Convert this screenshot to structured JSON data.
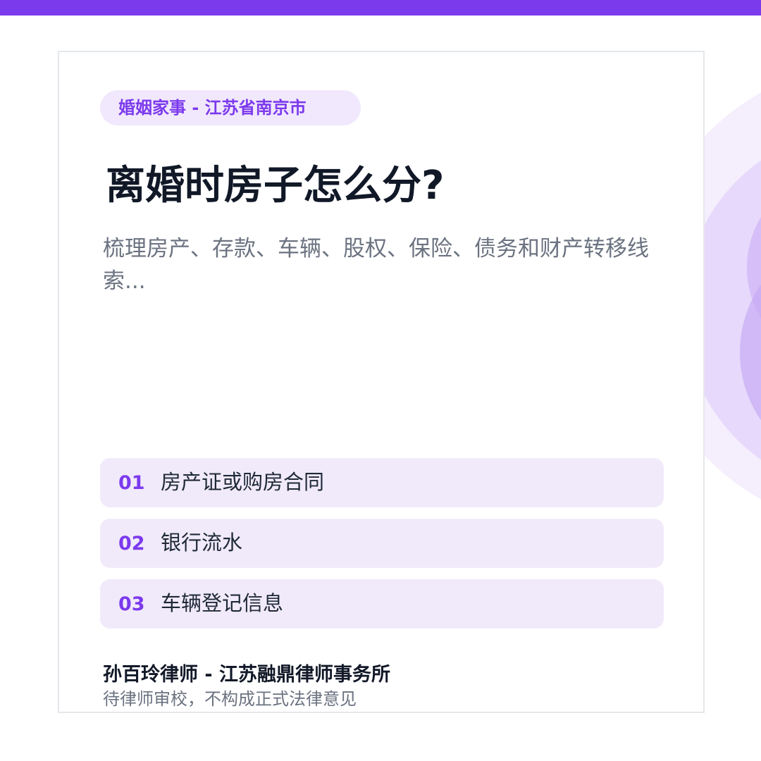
{
  "colors": {
    "accent": "#7c3aed",
    "tag_background": "#f1e8fd",
    "item_background": "#f1eafb",
    "title": "#111827",
    "muted": "#6b7280"
  },
  "tag": "婚姻家事 - 江苏省南京市",
  "title": "离婚时房子怎么分?",
  "subtitle": "梳理房产、存款、车辆、股权、保险、债务和财产转移线索...",
  "items": [
    {
      "num": "01",
      "text": "房产证或购房合同"
    },
    {
      "num": "02",
      "text": "银行流水"
    },
    {
      "num": "03",
      "text": "车辆登记信息"
    }
  ],
  "author": "孙百玲律师 - 江苏融鼎律师事务所",
  "note": "待律师审校，不构成正式法律意见"
}
